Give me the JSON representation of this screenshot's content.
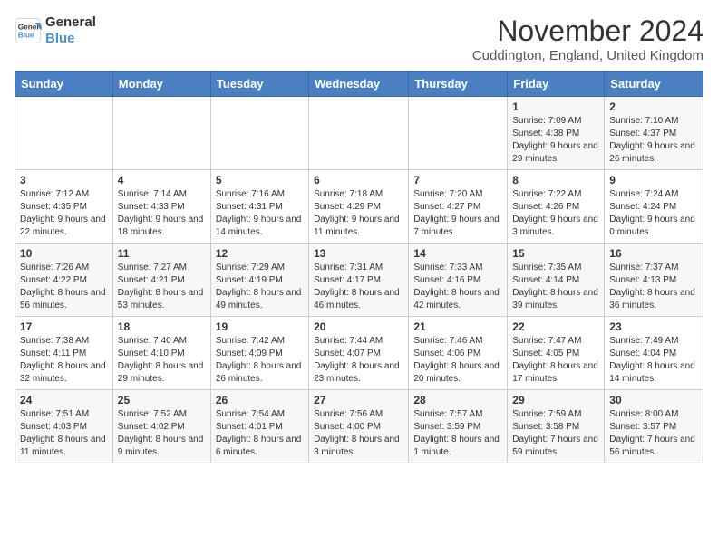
{
  "logo": {
    "line1": "General",
    "line2": "Blue"
  },
  "title": "November 2024",
  "location": "Cuddington, England, United Kingdom",
  "days_of_week": [
    "Sunday",
    "Monday",
    "Tuesday",
    "Wednesday",
    "Thursday",
    "Friday",
    "Saturday"
  ],
  "weeks": [
    [
      {
        "day": "",
        "info": ""
      },
      {
        "day": "",
        "info": ""
      },
      {
        "day": "",
        "info": ""
      },
      {
        "day": "",
        "info": ""
      },
      {
        "day": "",
        "info": ""
      },
      {
        "day": "1",
        "info": "Sunrise: 7:09 AM\nSunset: 4:38 PM\nDaylight: 9 hours and 29 minutes."
      },
      {
        "day": "2",
        "info": "Sunrise: 7:10 AM\nSunset: 4:37 PM\nDaylight: 9 hours and 26 minutes."
      }
    ],
    [
      {
        "day": "3",
        "info": "Sunrise: 7:12 AM\nSunset: 4:35 PM\nDaylight: 9 hours and 22 minutes."
      },
      {
        "day": "4",
        "info": "Sunrise: 7:14 AM\nSunset: 4:33 PM\nDaylight: 9 hours and 18 minutes."
      },
      {
        "day": "5",
        "info": "Sunrise: 7:16 AM\nSunset: 4:31 PM\nDaylight: 9 hours and 14 minutes."
      },
      {
        "day": "6",
        "info": "Sunrise: 7:18 AM\nSunset: 4:29 PM\nDaylight: 9 hours and 11 minutes."
      },
      {
        "day": "7",
        "info": "Sunrise: 7:20 AM\nSunset: 4:27 PM\nDaylight: 9 hours and 7 minutes."
      },
      {
        "day": "8",
        "info": "Sunrise: 7:22 AM\nSunset: 4:26 PM\nDaylight: 9 hours and 3 minutes."
      },
      {
        "day": "9",
        "info": "Sunrise: 7:24 AM\nSunset: 4:24 PM\nDaylight: 9 hours and 0 minutes."
      }
    ],
    [
      {
        "day": "10",
        "info": "Sunrise: 7:26 AM\nSunset: 4:22 PM\nDaylight: 8 hours and 56 minutes."
      },
      {
        "day": "11",
        "info": "Sunrise: 7:27 AM\nSunset: 4:21 PM\nDaylight: 8 hours and 53 minutes."
      },
      {
        "day": "12",
        "info": "Sunrise: 7:29 AM\nSunset: 4:19 PM\nDaylight: 8 hours and 49 minutes."
      },
      {
        "day": "13",
        "info": "Sunrise: 7:31 AM\nSunset: 4:17 PM\nDaylight: 8 hours and 46 minutes."
      },
      {
        "day": "14",
        "info": "Sunrise: 7:33 AM\nSunset: 4:16 PM\nDaylight: 8 hours and 42 minutes."
      },
      {
        "day": "15",
        "info": "Sunrise: 7:35 AM\nSunset: 4:14 PM\nDaylight: 8 hours and 39 minutes."
      },
      {
        "day": "16",
        "info": "Sunrise: 7:37 AM\nSunset: 4:13 PM\nDaylight: 8 hours and 36 minutes."
      }
    ],
    [
      {
        "day": "17",
        "info": "Sunrise: 7:38 AM\nSunset: 4:11 PM\nDaylight: 8 hours and 32 minutes."
      },
      {
        "day": "18",
        "info": "Sunrise: 7:40 AM\nSunset: 4:10 PM\nDaylight: 8 hours and 29 minutes."
      },
      {
        "day": "19",
        "info": "Sunrise: 7:42 AM\nSunset: 4:09 PM\nDaylight: 8 hours and 26 minutes."
      },
      {
        "day": "20",
        "info": "Sunrise: 7:44 AM\nSunset: 4:07 PM\nDaylight: 8 hours and 23 minutes."
      },
      {
        "day": "21",
        "info": "Sunrise: 7:46 AM\nSunset: 4:06 PM\nDaylight: 8 hours and 20 minutes."
      },
      {
        "day": "22",
        "info": "Sunrise: 7:47 AM\nSunset: 4:05 PM\nDaylight: 8 hours and 17 minutes."
      },
      {
        "day": "23",
        "info": "Sunrise: 7:49 AM\nSunset: 4:04 PM\nDaylight: 8 hours and 14 minutes."
      }
    ],
    [
      {
        "day": "24",
        "info": "Sunrise: 7:51 AM\nSunset: 4:03 PM\nDaylight: 8 hours and 11 minutes."
      },
      {
        "day": "25",
        "info": "Sunrise: 7:52 AM\nSunset: 4:02 PM\nDaylight: 8 hours and 9 minutes."
      },
      {
        "day": "26",
        "info": "Sunrise: 7:54 AM\nSunset: 4:01 PM\nDaylight: 8 hours and 6 minutes."
      },
      {
        "day": "27",
        "info": "Sunrise: 7:56 AM\nSunset: 4:00 PM\nDaylight: 8 hours and 3 minutes."
      },
      {
        "day": "28",
        "info": "Sunrise: 7:57 AM\nSunset: 3:59 PM\nDaylight: 8 hours and 1 minute."
      },
      {
        "day": "29",
        "info": "Sunrise: 7:59 AM\nSunset: 3:58 PM\nDaylight: 7 hours and 59 minutes."
      },
      {
        "day": "30",
        "info": "Sunrise: 8:00 AM\nSunset: 3:57 PM\nDaylight: 7 hours and 56 minutes."
      }
    ]
  ]
}
